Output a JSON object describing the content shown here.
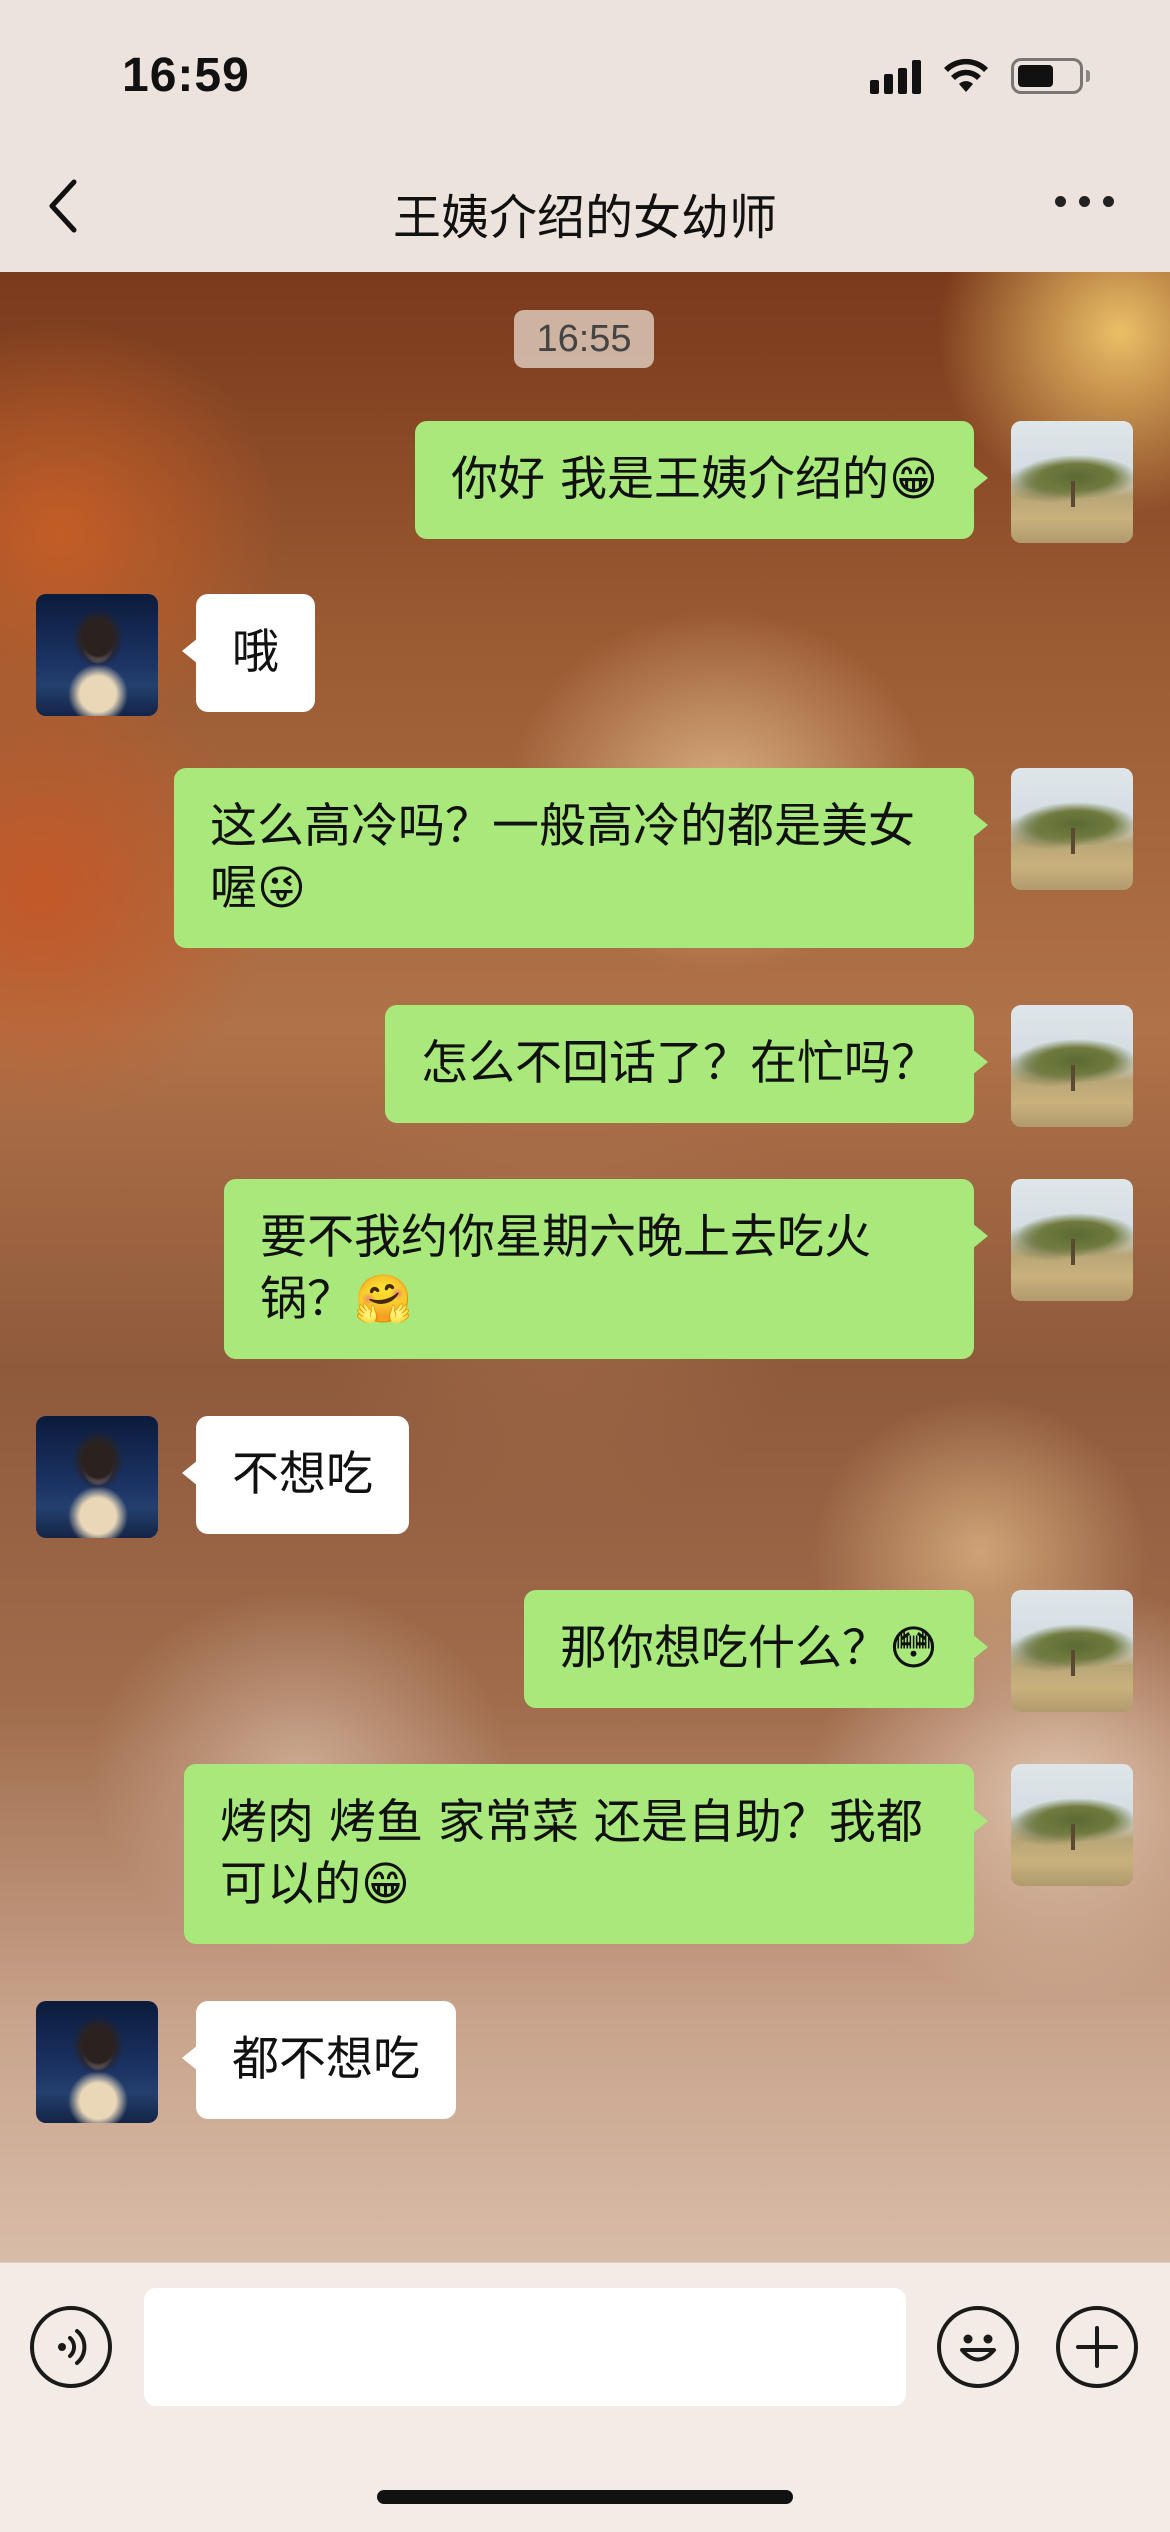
{
  "status_bar": {
    "time": "16:59"
  },
  "nav": {
    "title": "王姨介绍的女幼师"
  },
  "chat": {
    "timestamp": "16:55",
    "messages": [
      {
        "from": "me",
        "text": "你好 我是王姨介绍的😁"
      },
      {
        "from": "her",
        "text": "哦"
      },
      {
        "from": "me",
        "text": "这么高冷吗？一般高冷的都是美女喔😜"
      },
      {
        "from": "me",
        "text": "怎么不回话了？在忙吗？"
      },
      {
        "from": "me",
        "text": "要不我约你星期六晚上去吃火锅？🤗"
      },
      {
        "from": "her",
        "text": "不想吃"
      },
      {
        "from": "me",
        "text": "那你想吃什么？😳"
      },
      {
        "from": "me",
        "text": "烤肉 烤鱼 家常菜 还是自助？我都可以的😁"
      },
      {
        "from": "her",
        "text": "都不想吃"
      }
    ]
  },
  "input_bar": {
    "voice_icon": "voice-icon",
    "emoji_icon": "emoji-icon",
    "plus_icon": "plus-icon",
    "input_value": ""
  },
  "colors": {
    "my_bubble": "#a9e97c",
    "her_bubble": "#ffffff",
    "top_bar": "#ece3dc"
  }
}
